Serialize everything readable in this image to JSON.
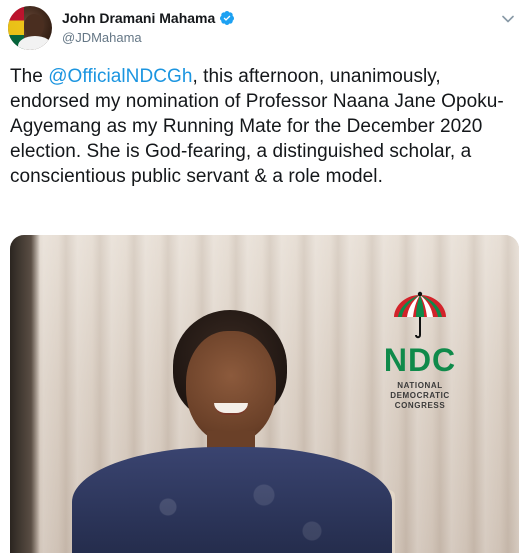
{
  "author": {
    "display_name": "John Dramani Mahama",
    "handle": "@JDMahama",
    "verified": true,
    "avatar_icon": "profile-photo-with-ghana-flag"
  },
  "menu_icon": "chevron-down-icon",
  "tweet": {
    "prefix": "The ",
    "mention": "@OfficialNDCGh",
    "body": ", this afternoon, unanimously, endorsed my nomination of Professor Naana Jane Opoku-Agyemang as my Running Mate for the December 2020 election. She is God-fearing, a distinguished scholar, a conscientious public servant & a role model."
  },
  "media": {
    "logo_abbrev": "NDC",
    "logo_line1": "NATIONAL",
    "logo_line2": "DEMOCRATIC",
    "logo_line3": "CONGRESS"
  },
  "colors": {
    "link": "#1b95e0",
    "text": "#14171a",
    "secondary": "#657786",
    "ndc_green": "#0f8a4a",
    "ndc_red": "#d2232a"
  }
}
